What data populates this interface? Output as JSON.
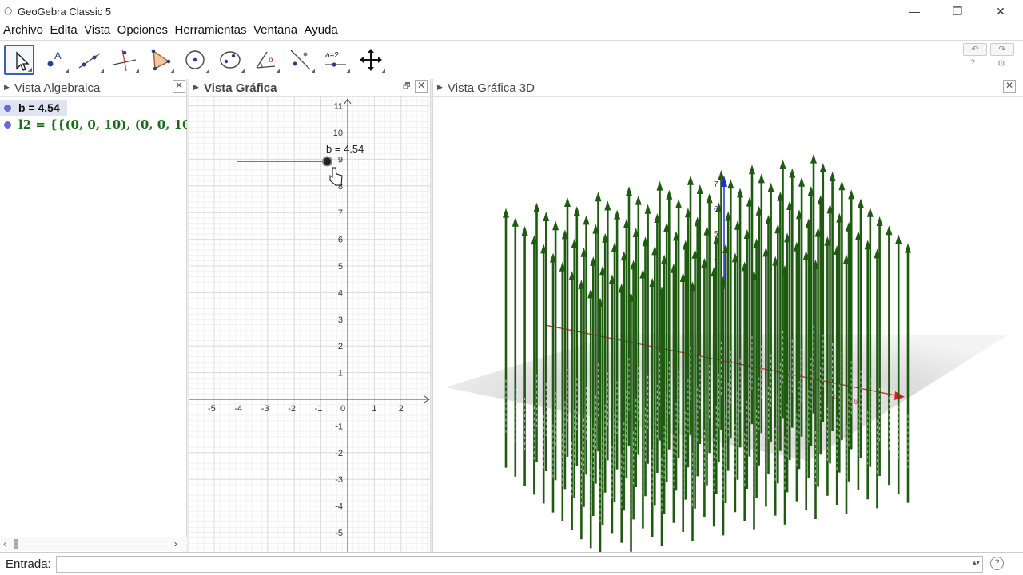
{
  "window": {
    "title": "GeoGebra Classic 5",
    "minimize": "—",
    "restore": "❐",
    "close": "✕"
  },
  "menu": [
    "Archivo",
    "Edita",
    "Vista",
    "Opciones",
    "Herramientas",
    "Ventana",
    "Ayuda"
  ],
  "toolbar": {
    "tools": [
      "move-tool",
      "point-tool",
      "line-tool",
      "perpendicular-line-tool",
      "polygon-tool",
      "circle-tool",
      "conic-tool",
      "angle-tool",
      "reflect-tool",
      "slider-tool",
      "move-view-tool"
    ],
    "slider_tool_label": "a=2",
    "undo": "↶",
    "redo": "↷",
    "help": "?",
    "settings": "⚙"
  },
  "algebra_view": {
    "title": "Vista Algebraica",
    "items": [
      {
        "expr": "b = 4.54"
      },
      {
        "expr": "l2 = {{(0, 0, 10), (0, 0, 10)"
      }
    ]
  },
  "graphics_view": {
    "title": "Vista Gráfica",
    "slider_label": "b = 4.54",
    "slider_value": 4.54,
    "x_ticks": [
      "-5",
      "-4",
      "-3",
      "-2",
      "-1",
      "0",
      "1",
      "2"
    ],
    "y_ticks": [
      "11",
      "10",
      "9",
      "8",
      "7",
      "6",
      "5",
      "4",
      "3",
      "2",
      "1",
      "-1",
      "-2",
      "-3",
      "-4",
      "-5"
    ]
  },
  "view_3d": {
    "title": "Vista Gráfica 3D",
    "z_labels": [
      "7",
      "6",
      "5",
      "4"
    ],
    "x_labels": [
      "2",
      "4",
      "6",
      "8"
    ],
    "colors": {
      "vectors": "#1e5a10",
      "x_axis": "#d42020",
      "z_axis": "#2030c0"
    }
  },
  "input_bar": {
    "label": "Entrada:",
    "value": "",
    "help": "?"
  }
}
